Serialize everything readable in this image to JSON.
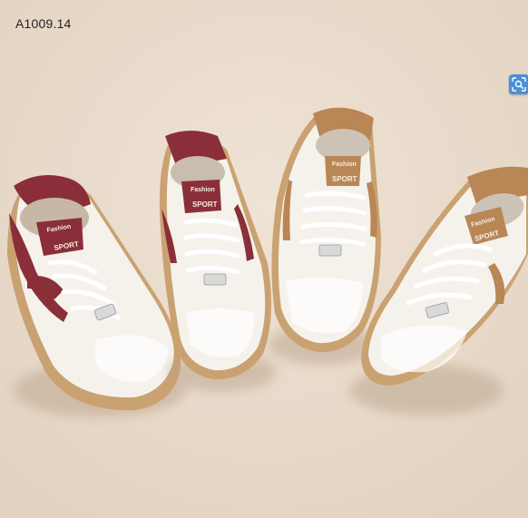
{
  "product": {
    "code": "A1009.14"
  },
  "tongue_label": {
    "script": "Fashion",
    "brand": "SPORT"
  },
  "overlay": {
    "icon": "visual-search-icon"
  },
  "colors": {
    "background": "#e9dccd",
    "burgundy": "#8a2f3a",
    "tan": "#b98656",
    "upper": "#f6f3ee",
    "sole": "#c9a577"
  }
}
